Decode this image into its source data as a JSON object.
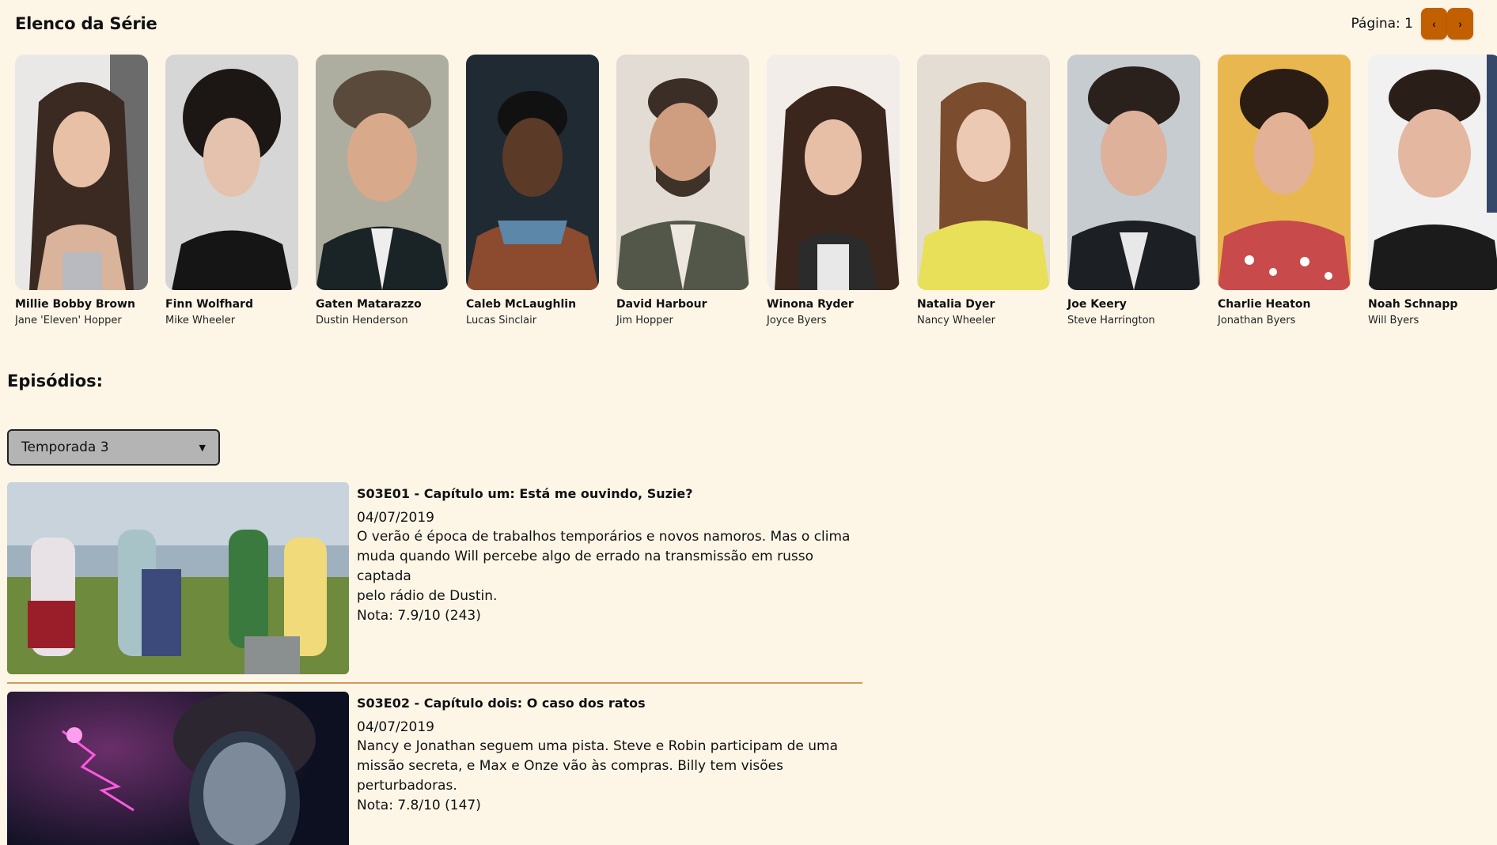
{
  "cast_section": {
    "title": "Elenco da Série",
    "page_label": "Página: 1",
    "prev_icon": "chevron-left-icon",
    "next_icon": "chevron-right-icon",
    "accent_color": "#c25f00",
    "cast": [
      {
        "name": "Millie Bobby Brown",
        "role": "Jane 'Eleven' Hopper"
      },
      {
        "name": "Finn Wolfhard",
        "role": "Mike Wheeler"
      },
      {
        "name": "Gaten Matarazzo",
        "role": "Dustin Henderson"
      },
      {
        "name": "Caleb McLaughlin",
        "role": "Lucas Sinclair"
      },
      {
        "name": "David Harbour",
        "role": "Jim Hopper"
      },
      {
        "name": "Winona Ryder",
        "role": "Joyce Byers"
      },
      {
        "name": "Natalia Dyer",
        "role": "Nancy Wheeler"
      },
      {
        "name": "Joe Keery",
        "role": "Steve Harrington"
      },
      {
        "name": "Charlie Heaton",
        "role": "Jonathan Byers"
      },
      {
        "name": "Noah Schnapp",
        "role": "Will Byers"
      }
    ]
  },
  "episodes_section": {
    "title": "Episódios:",
    "season_select": {
      "selected": "Temporada 3"
    },
    "episodes": [
      {
        "title": "S03E01 - Capítulo um: Está me ouvindo, Suzie?",
        "date": "04/07/2019",
        "description_lines": [
          "O verão é época de trabalhos temporários e novos namoros. Mas o clima",
          "muda quando Will percebe algo de errado na transmissão em russo captada",
          "pelo rádio de Dustin."
        ],
        "rating": "Nota: 7.9/10 (243)"
      },
      {
        "title": "S03E02 - Capítulo dois: O caso dos ratos",
        "date": "04/07/2019",
        "description_lines": [
          "Nancy e Jonathan seguem uma pista. Steve e Robin participam de uma",
          "missão secreta, e Max e Onze vão às compras. Billy tem visões perturbadoras."
        ],
        "rating": "Nota: 7.8/10 (147)"
      }
    ]
  }
}
